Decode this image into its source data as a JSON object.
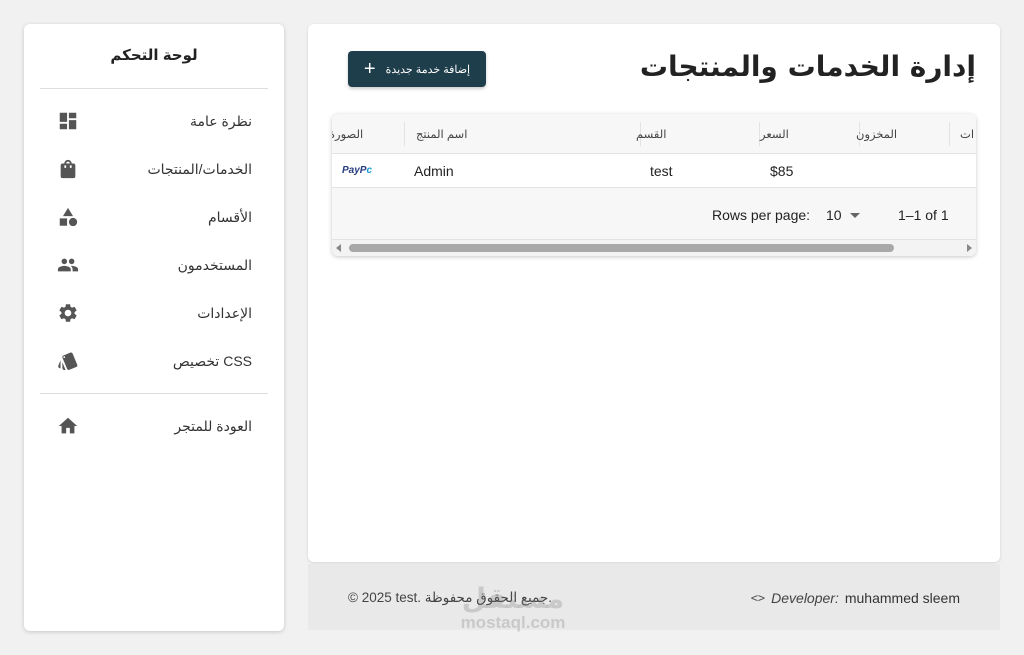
{
  "sidebar": {
    "title": "لوحة التحكم",
    "items": [
      {
        "label": "نظرة عامة",
        "icon": "dashboard-icon"
      },
      {
        "label": "الخدمات/المنتجات",
        "icon": "shopping-bag-icon"
      },
      {
        "label": "الأقسام",
        "icon": "category-shapes-icon"
      },
      {
        "label": "المستخدمون",
        "icon": "people-icon"
      },
      {
        "label": "الإعدادات",
        "icon": "gear-icon"
      },
      {
        "label": "CSS تخصيص",
        "icon": "style-icon"
      }
    ],
    "back": {
      "label": "العودة للمتجر",
      "icon": "home-icon"
    }
  },
  "main": {
    "title": "إدارة الخدمات والمنتجات",
    "add_button": {
      "label": "إضافة خدمة جديدة",
      "icon": "plus-icon"
    }
  },
  "table": {
    "columns": [
      "الصورة",
      "اسم المنتج",
      "القسم",
      "السعر",
      "المخزون",
      "ات"
    ],
    "rows": [
      {
        "image_text_1": "PayP",
        "image_text_2": "c",
        "name": "Admin",
        "category": "test",
        "price": "$85",
        "stock": "",
        "actions": ""
      }
    ],
    "pagination": {
      "rows_per_page_label": "Rows per page:",
      "rows_per_page_value": "10",
      "range": "1–1 of 1"
    }
  },
  "footer": {
    "copyright": "© 2025 test. جميع الحقوق محفوظة.",
    "developer_label": "Developer:",
    "developer_name": "muhammed sleem",
    "watermark_ar": "مستقل",
    "watermark_en": "mostaql.com"
  },
  "colors": {
    "accent": "#1f3e4b",
    "background": "#f1f1f1",
    "card": "#ffffff"
  }
}
